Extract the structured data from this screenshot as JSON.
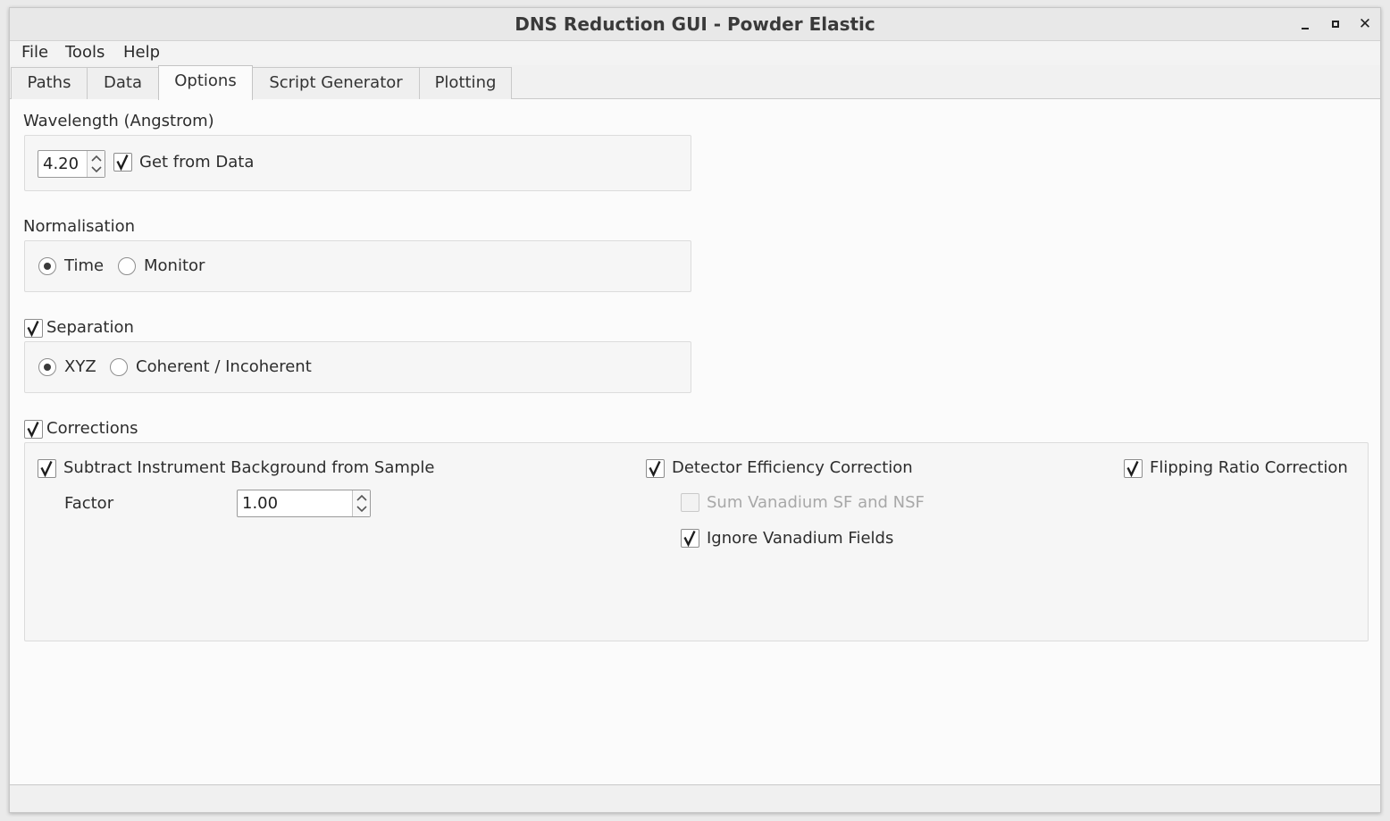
{
  "window": {
    "title": "DNS Reduction GUI - Powder Elastic"
  },
  "menu": [
    "File",
    "Tools",
    "Help"
  ],
  "tabs": [
    "Paths",
    "Data",
    "Options",
    "Script Generator",
    "Plotting"
  ],
  "active_tab": "Options",
  "wavelength": {
    "title": "Wavelength (Angstrom)",
    "value": "4.20",
    "get_from_data_label": "Get from Data",
    "get_from_data_checked": true
  },
  "normalisation": {
    "title": "Normalisation",
    "options": [
      "Time",
      "Monitor"
    ],
    "selected": "Time"
  },
  "separation": {
    "title": "Separation",
    "checked": true,
    "options": [
      "XYZ",
      "Coherent / Incoherent"
    ],
    "selected": "XYZ"
  },
  "corrections": {
    "title": "Corrections",
    "checked": true,
    "subtract_bg_label": "Subtract Instrument Background from Sample",
    "subtract_bg_checked": true,
    "factor_label": "Factor",
    "factor_value": "1.00",
    "detector_eff_label": "Detector Efficiency Correction",
    "detector_eff_checked": true,
    "sum_vanadium_label": "Sum Vanadium SF and NSF",
    "sum_vanadium_checked": false,
    "ignore_vanadium_label": "Ignore Vanadium Fields",
    "ignore_vanadium_checked": true,
    "flipping_ratio_label": "Flipping Ratio Correction",
    "flipping_ratio_checked": true
  },
  "colors": {
    "accent": "#3a3a3a",
    "border": "#c9c9c9",
    "panel": "#f6f6f6",
    "disabled_text": "#a8a8a8"
  },
  "icons": {
    "check": "checkmark-icon",
    "spin_up": "spin-up-arrow-icon",
    "spin_down": "spin-down-arrow-icon",
    "minimize": "minimize-icon",
    "maximize": "maximize-icon",
    "close": "close-icon"
  }
}
